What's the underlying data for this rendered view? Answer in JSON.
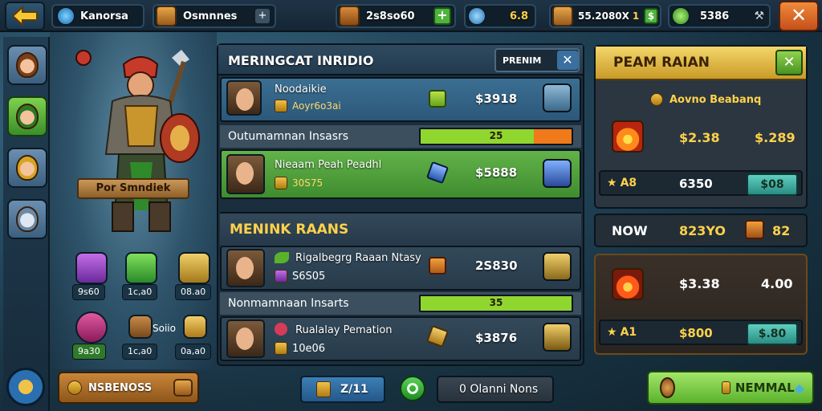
{
  "topbar": {
    "player_name": "Kanorsa",
    "resource1": "Osmnnes",
    "resource2": "2s8so60",
    "resource3": "6.8",
    "resource4": "55.2080X",
    "resource4_extra": "1",
    "resource5": "5386",
    "close_label": "✕",
    "back_label": "⬅"
  },
  "hero": {
    "name_banner": "Por Smndiek",
    "items": [
      {
        "price": "9s60"
      },
      {
        "price": "1c,a0"
      },
      {
        "price": "08.a0"
      },
      {
        "price": "9a30"
      },
      {
        "price": "Soiio"
      },
      {
        "price": "1c,a0"
      },
      {
        "price": "0a,a0"
      }
    ]
  },
  "center": {
    "title": "MERINGCAT INRIDIO",
    "tab_label": "PRENIM",
    "rows_top": [
      {
        "name": "Noodaikie",
        "sub": "Aoyr6o3ai",
        "price": "$3918"
      },
      {
        "name": "Nieaam Peah Peadhl",
        "sub": "30S75",
        "price": "$5888"
      }
    ],
    "section1_label": "Outumamnan Insasrs",
    "progress1_label": "25",
    "progress1_value": 0.75,
    "subheader": "MENINK RAANS",
    "rows_bottom": [
      {
        "name": "Rigalbegrg Raaan Ntasy",
        "sub": "S6S05",
        "price": "2S830"
      },
      {
        "name": "Rualalay Pemation",
        "sub": "10e06",
        "price": "$3876"
      }
    ],
    "section2_label": "Nonmamnaan Insarts",
    "progress2_label": "35",
    "progress2_value": 1.0
  },
  "right": {
    "title": "PEAM RAIAN",
    "close_label": "✕",
    "sub_label": "Aovno Beabanq",
    "top_values": [
      "$2.38",
      "$.289"
    ],
    "stat_left": "A8",
    "stat_mid": "6350",
    "btn1": "$08",
    "now_label": "NOW",
    "now_value": "823YO",
    "now_extra": "82",
    "bottom_values": [
      "$3.38",
      "4.00"
    ],
    "stat2_left": "A1",
    "stat2_mid": "$800",
    "btn2": "$.80"
  },
  "bottom": {
    "left_button": "NSBENOSS",
    "center_button": "Z/11",
    "dark_button": "0 Olanni Nons",
    "right_button": "NEMMAL"
  },
  "colors": {
    "gold_text": "#ffd24a",
    "green_bar": "#8fd62f",
    "orange_bar": "#f07a1a"
  }
}
